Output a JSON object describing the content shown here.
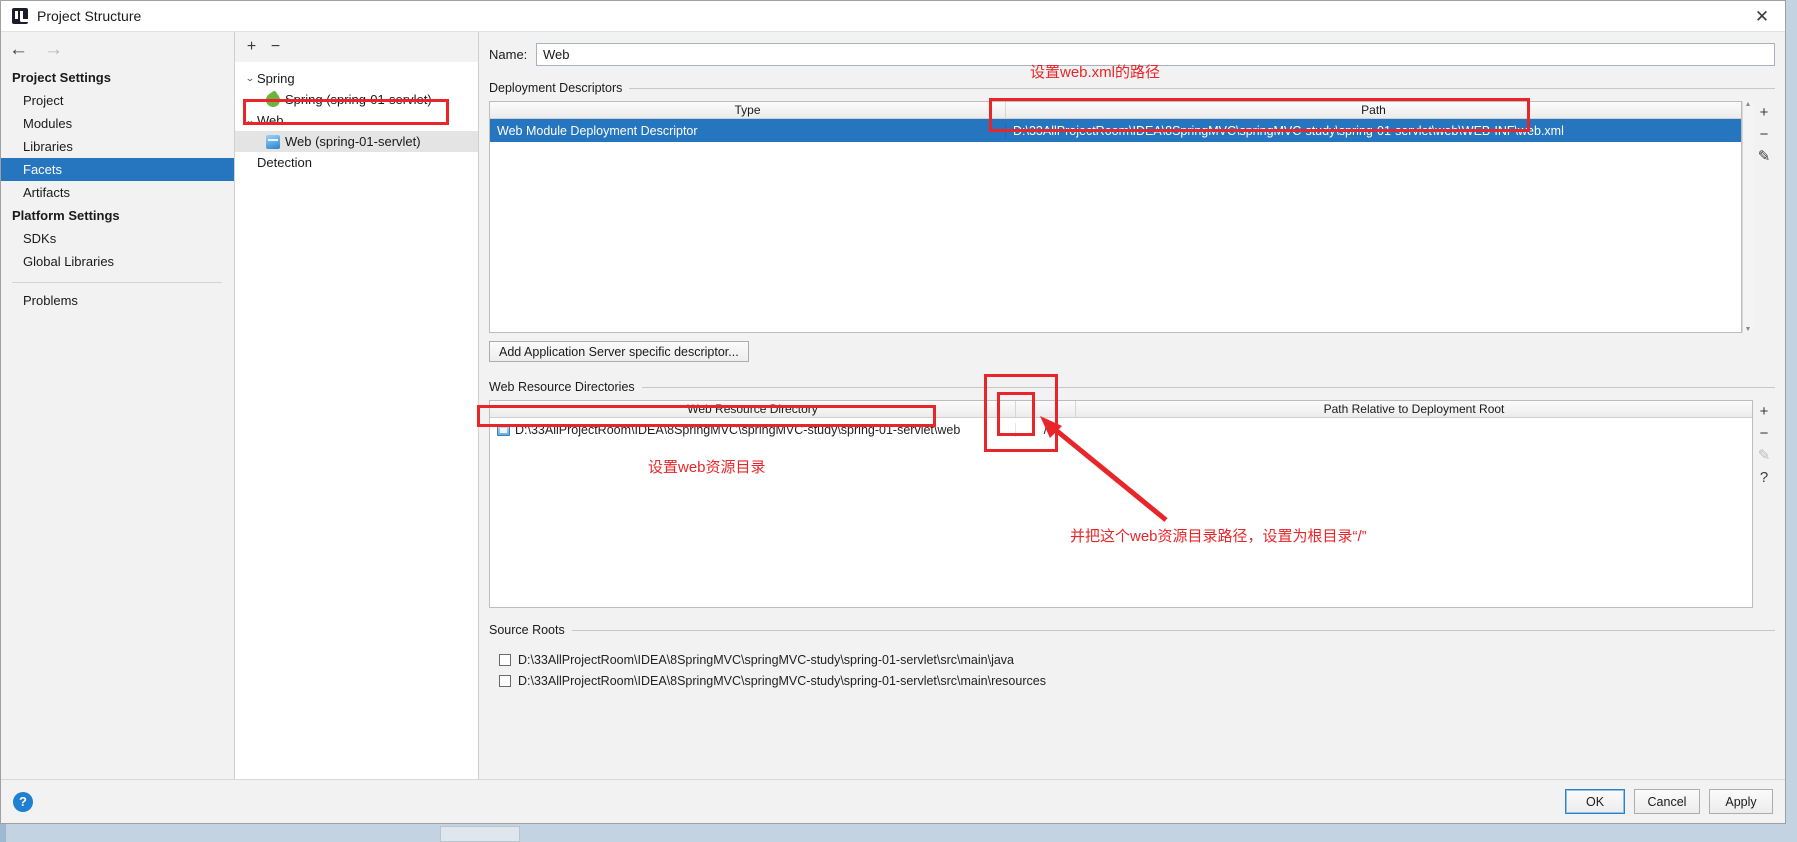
{
  "window": {
    "title": "Project Structure",
    "app_icon": "intellij-idea-icon",
    "close_icon": "close-icon"
  },
  "settings_pane": {
    "back_icon": "arrow-left-icon",
    "forward_icon": "arrow-right-icon",
    "groups": [
      {
        "title": "Project Settings",
        "items": [
          {
            "label": "Project",
            "selected": false
          },
          {
            "label": "Modules",
            "selected": false
          },
          {
            "label": "Libraries",
            "selected": false
          },
          {
            "label": "Facets",
            "selected": true
          },
          {
            "label": "Artifacts",
            "selected": false
          }
        ]
      },
      {
        "title": "Platform Settings",
        "items": [
          {
            "label": "SDKs",
            "selected": false
          },
          {
            "label": "Global Libraries",
            "selected": false
          }
        ]
      }
    ],
    "problems_label": "Problems"
  },
  "facets_pane": {
    "add_icon": "plus-icon",
    "remove_icon": "minus-icon",
    "add_label": "+",
    "remove_label": "−",
    "tree": [
      {
        "label": "Spring",
        "level": 1,
        "twisty": "⌄",
        "icon": null,
        "selected": false
      },
      {
        "label": "Spring (spring-01-servlet)",
        "level": 2,
        "twisty": "",
        "icon": "spring-leaf-icon",
        "selected": false
      },
      {
        "label": "Web",
        "level": 1,
        "twisty": "⌄",
        "icon": null,
        "selected": false
      },
      {
        "label": "Web (spring-01-servlet)",
        "level": 2,
        "twisty": "",
        "icon": "web-facet-icon",
        "selected": true
      },
      {
        "label": "Detection",
        "level": 1,
        "twisty": "",
        "icon": null,
        "selected": false
      }
    ]
  },
  "detail": {
    "name_label": "Name:",
    "name_value": "Web",
    "deployment_descriptors": {
      "section_title": "Deployment Descriptors",
      "columns": [
        "Type",
        "Path"
      ],
      "rows": [
        {
          "type": "Web Module Deployment Descriptor",
          "path": "D:\\33AllProjectRoom\\IDEA\\8SpringMVC\\springMVC-study\\spring-01-servlet\\web\\WEB-INF\\web.xml",
          "selected": true
        }
      ],
      "rail": [
        {
          "name": "add-descriptor-button",
          "glyph": "+",
          "disabled": false
        },
        {
          "name": "remove-descriptor-button",
          "glyph": "−",
          "disabled": false
        },
        {
          "name": "edit-descriptor-button",
          "glyph": "✎",
          "disabled": false
        }
      ],
      "add_server_descriptor_label": "Add Application Server specific descriptor..."
    },
    "web_resource_directories": {
      "section_title": "Web Resource Directories",
      "columns": [
        "Web Resource Directory",
        "Path Relative to Deployment Root"
      ],
      "rows": [
        {
          "directory": "D:\\33AllProjectRoom\\IDEA\\8SpringMVC\\springMVC-study\\spring-01-servlet\\web",
          "relative_path": "/",
          "icon": "folder-icon"
        }
      ],
      "rail": [
        {
          "name": "add-resource-dir-button",
          "glyph": "+",
          "disabled": false
        },
        {
          "name": "remove-resource-dir-button",
          "glyph": "−",
          "disabled": false
        },
        {
          "name": "edit-resource-dir-button",
          "glyph": "✎",
          "disabled": true
        },
        {
          "name": "help-resource-dir-button",
          "glyph": "?",
          "disabled": false
        }
      ]
    },
    "source_roots": {
      "section_title": "Source Roots",
      "rows": [
        {
          "path": "D:\\33AllProjectRoom\\IDEA\\8SpringMVC\\springMVC-study\\spring-01-servlet\\src\\main\\java",
          "checked": false
        },
        {
          "path": "D:\\33AllProjectRoom\\IDEA\\8SpringMVC\\springMVC-study\\spring-01-servlet\\src\\main\\resources",
          "checked": false
        }
      ]
    }
  },
  "bottom_bar": {
    "help_label": "?",
    "ok_label": "OK",
    "cancel_label": "Cancel",
    "apply_label": "Apply"
  },
  "annotations": {
    "color": "#e8262a",
    "notes": [
      {
        "id": "note-webxml-path",
        "text": "设置web.xml的路径"
      },
      {
        "id": "note-web-resource-dir",
        "text": "设置web资源目录"
      },
      {
        "id": "note-root-path",
        "text": "并把这个web资源目录路径，设置为根目录“/”"
      }
    ]
  }
}
